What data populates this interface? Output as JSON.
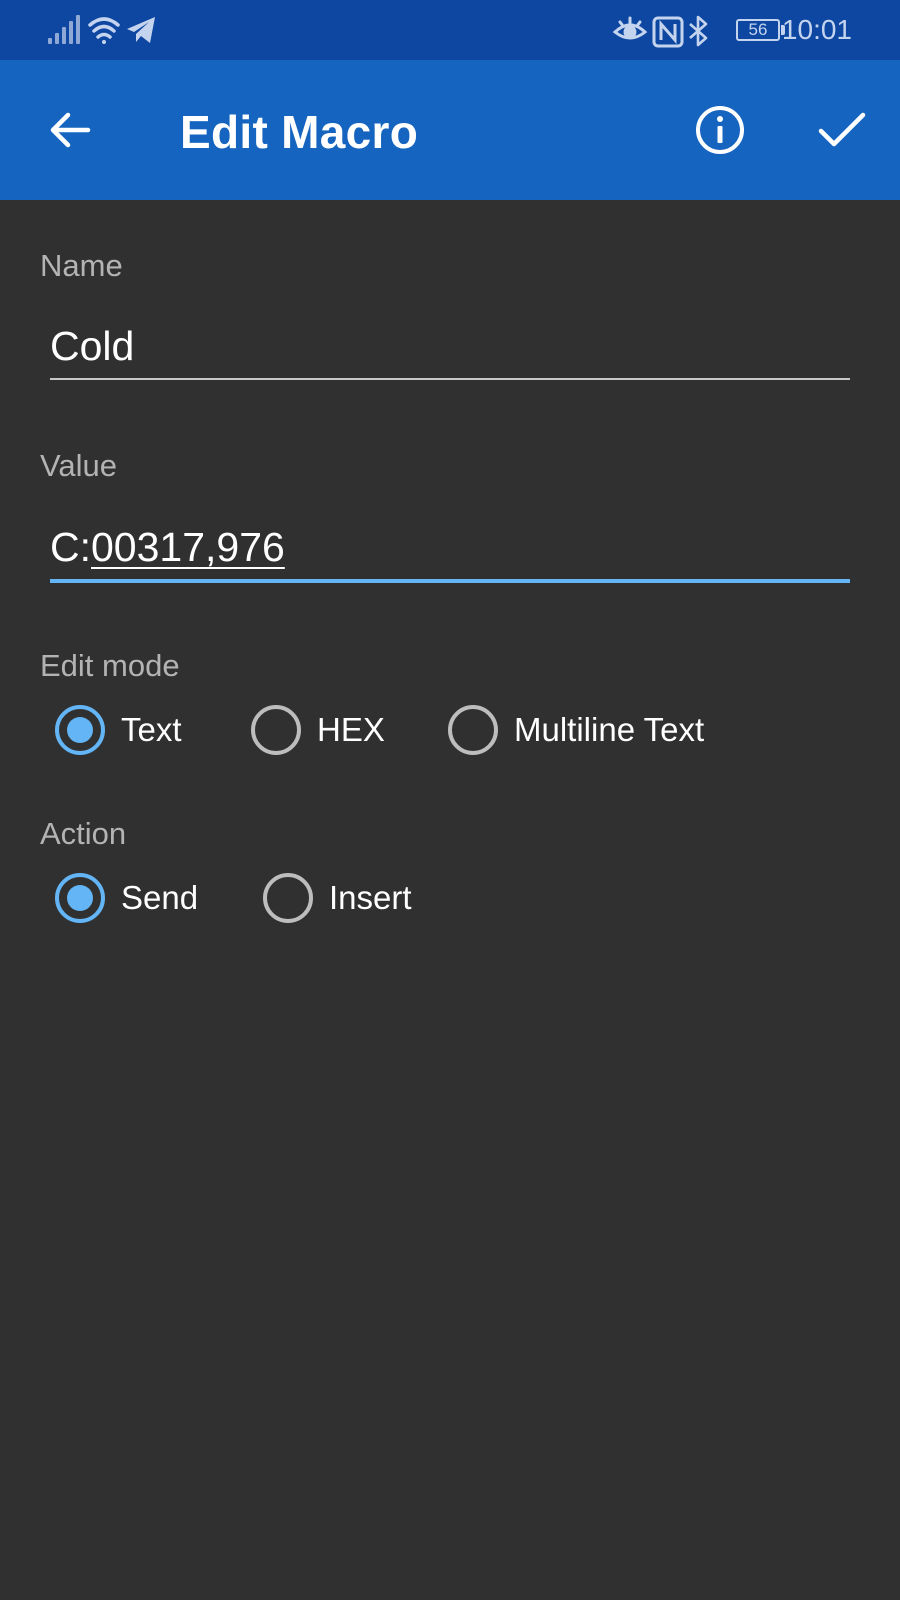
{
  "status_bar": {
    "time": "10:01",
    "battery": "56",
    "icons": [
      "signal-icon",
      "wifi-icon",
      "telegram-icon",
      "eye-icon",
      "nfc-icon",
      "bluetooth-icon",
      "battery-icon"
    ]
  },
  "app_bar": {
    "title": "Edit Macro",
    "icons": [
      "back-arrow-icon",
      "info-icon",
      "check-icon"
    ]
  },
  "form": {
    "name": {
      "label": "Name",
      "value": "Cold"
    },
    "value": {
      "label": "Value",
      "prefix": "C:",
      "rest": "00317,976"
    },
    "edit_mode": {
      "label": "Edit mode",
      "options": [
        "Text",
        "HEX",
        "Multiline Text"
      ],
      "selected": "Text"
    },
    "action": {
      "label": "Action",
      "options": [
        "Send",
        "Insert"
      ],
      "selected": "Send"
    }
  },
  "colors": {
    "status_bar": "#0d47a1",
    "app_bar": "#1565c0",
    "background": "#303030",
    "accent": "#64b5f6"
  }
}
